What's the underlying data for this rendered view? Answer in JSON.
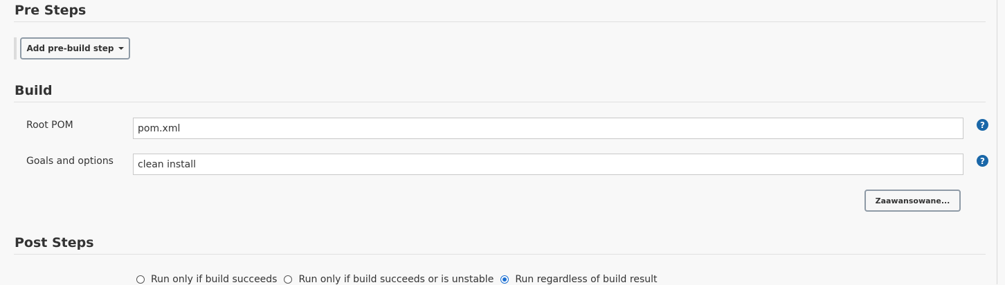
{
  "pre_steps": {
    "title": "Pre Steps",
    "add_button_label": "Add pre-build step"
  },
  "build": {
    "title": "Build",
    "fields": [
      {
        "label": "Root POM",
        "value": "pom.xml"
      },
      {
        "label": "Goals and options",
        "value": "clean install"
      }
    ],
    "advanced_button_label": "Zaawansowane..."
  },
  "post_steps": {
    "title": "Post Steps",
    "options": [
      {
        "label": "Run only if build succeeds",
        "checked": false
      },
      {
        "label": "Run only if build succeeds or is unstable",
        "checked": false
      },
      {
        "label": "Run regardless of build result",
        "checked": true
      }
    ]
  },
  "colors": {
    "help_icon": "#1a67a8",
    "radio_selected": "#1c6fd1",
    "background": "#f8f8f8"
  },
  "icons": {
    "help": "help-icon",
    "dropdown": "caret-down-icon"
  }
}
